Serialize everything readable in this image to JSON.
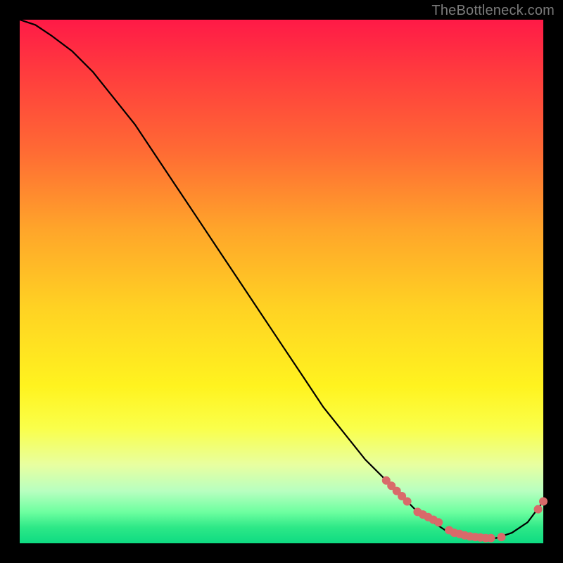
{
  "watermark": "TheBottleneck.com",
  "chart_data": {
    "type": "line",
    "title": "",
    "xlabel": "",
    "ylabel": "",
    "xlim": [
      0,
      100
    ],
    "ylim": [
      0,
      100
    ],
    "grid": false,
    "legend": false,
    "series": [
      {
        "name": "curve",
        "color": "#000000",
        "x": [
          0,
          3,
          6,
          10,
          14,
          18,
          22,
          26,
          30,
          34,
          38,
          42,
          46,
          50,
          54,
          58,
          62,
          66,
          70,
          73,
          76,
          79,
          82,
          85,
          88,
          91,
          94,
          97,
          100
        ],
        "y": [
          100,
          99,
          97,
          94,
          90,
          85,
          80,
          74,
          68,
          62,
          56,
          50,
          44,
          38,
          32,
          26,
          21,
          16,
          12,
          9,
          6,
          4,
          2,
          1,
          1,
          1,
          2,
          4,
          8
        ]
      },
      {
        "name": "markers",
        "type": "scatter",
        "color": "#d96a6a",
        "x": [
          70,
          71,
          72,
          73,
          74,
          76,
          77,
          78,
          79,
          80,
          82,
          83,
          84,
          85,
          86,
          87,
          88,
          89,
          90,
          92,
          99,
          100
        ],
        "y": [
          12,
          11,
          10,
          9,
          8,
          6,
          5.5,
          5,
          4.5,
          4,
          2.5,
          2,
          1.8,
          1.5,
          1.3,
          1.2,
          1.1,
          1,
          1,
          1.2,
          6.5,
          8
        ]
      }
    ]
  }
}
